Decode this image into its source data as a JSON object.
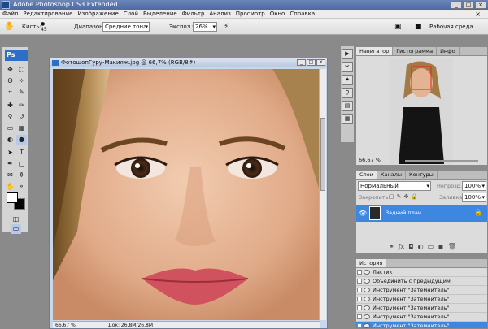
{
  "titlebar": {
    "title": "Adobe Photoshop CS3 Extended",
    "min": "_",
    "max": "□",
    "close": "×"
  },
  "menu": [
    "Файл",
    "Редактирование",
    "Изображение",
    "Слой",
    "Выделение",
    "Фильтр",
    "Анализ",
    "Просмотр",
    "Окно",
    "Справка"
  ],
  "options": {
    "brush_label": "Кисть:",
    "brush_size": "45",
    "range_label": "Диапазон:",
    "range_value": "Средние тона",
    "exposure_label": "Экспоз.:",
    "exposure_value": "26%",
    "workspace_label": "Рабочая среда"
  },
  "toolbox": {
    "logo": "Ps"
  },
  "document": {
    "title": "ФотошопГуру-Макияж.jpg @ 66,7% (RGB/8#)",
    "zoom": "66,67 %",
    "doc_size": "Док: 26,8M/26,8M"
  },
  "navigator": {
    "tabs": [
      "Навигатор",
      "Гистограмма",
      "Инфо"
    ],
    "zoom": "66,67 %"
  },
  "layers": {
    "tabs": [
      "Слои",
      "Каналы",
      "Контуры"
    ],
    "blend_mode": "Нормальный",
    "opacity_label": "Непрозр.:",
    "opacity_value": "100%",
    "lock_label": "Закрепить:",
    "fill_label": "Заливка:",
    "fill_value": "100%",
    "layer_name": "Задний план"
  },
  "history": {
    "tab": "История",
    "items": [
      "Ластик",
      "Объединить с предыдущим",
      "Инструмент \"Затемнитель\"",
      "Инструмент \"Затемнитель\"",
      "Инструмент \"Затемнитель\"",
      "Инструмент \"Затемнитель\"",
      "Инструмент \"Затемнитель\""
    ]
  }
}
